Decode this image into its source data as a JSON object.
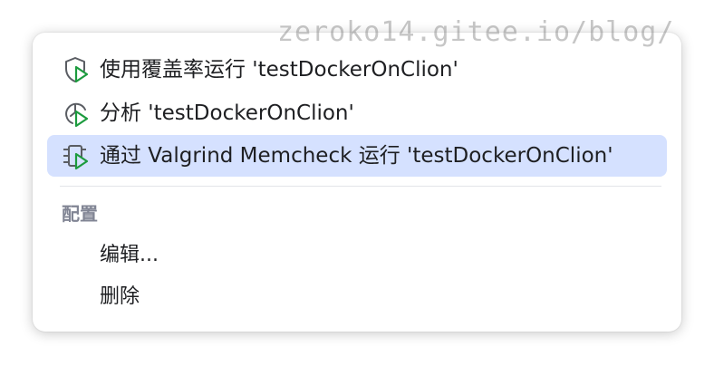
{
  "watermark": "zeroko14.gitee.io/blog/",
  "menu": {
    "items": [
      {
        "label": "使用覆盖率运行 'testDockerOnClion'",
        "icon": "shield-run-icon"
      },
      {
        "label": "分析 'testDockerOnClion'",
        "icon": "profiler-run-icon"
      },
      {
        "label": "通过 Valgrind Memcheck 运行 'testDockerOnClion'",
        "icon": "memcheck-run-icon",
        "selected": true
      }
    ],
    "section_header": "配置",
    "config_items": [
      {
        "label": "编辑..."
      },
      {
        "label": "删除"
      }
    ]
  },
  "colors": {
    "selected_background": "#d5e1ff",
    "run_triangle": "#1c9b3e",
    "icon_stroke": "#5a5d63",
    "section_header": "#818594"
  }
}
